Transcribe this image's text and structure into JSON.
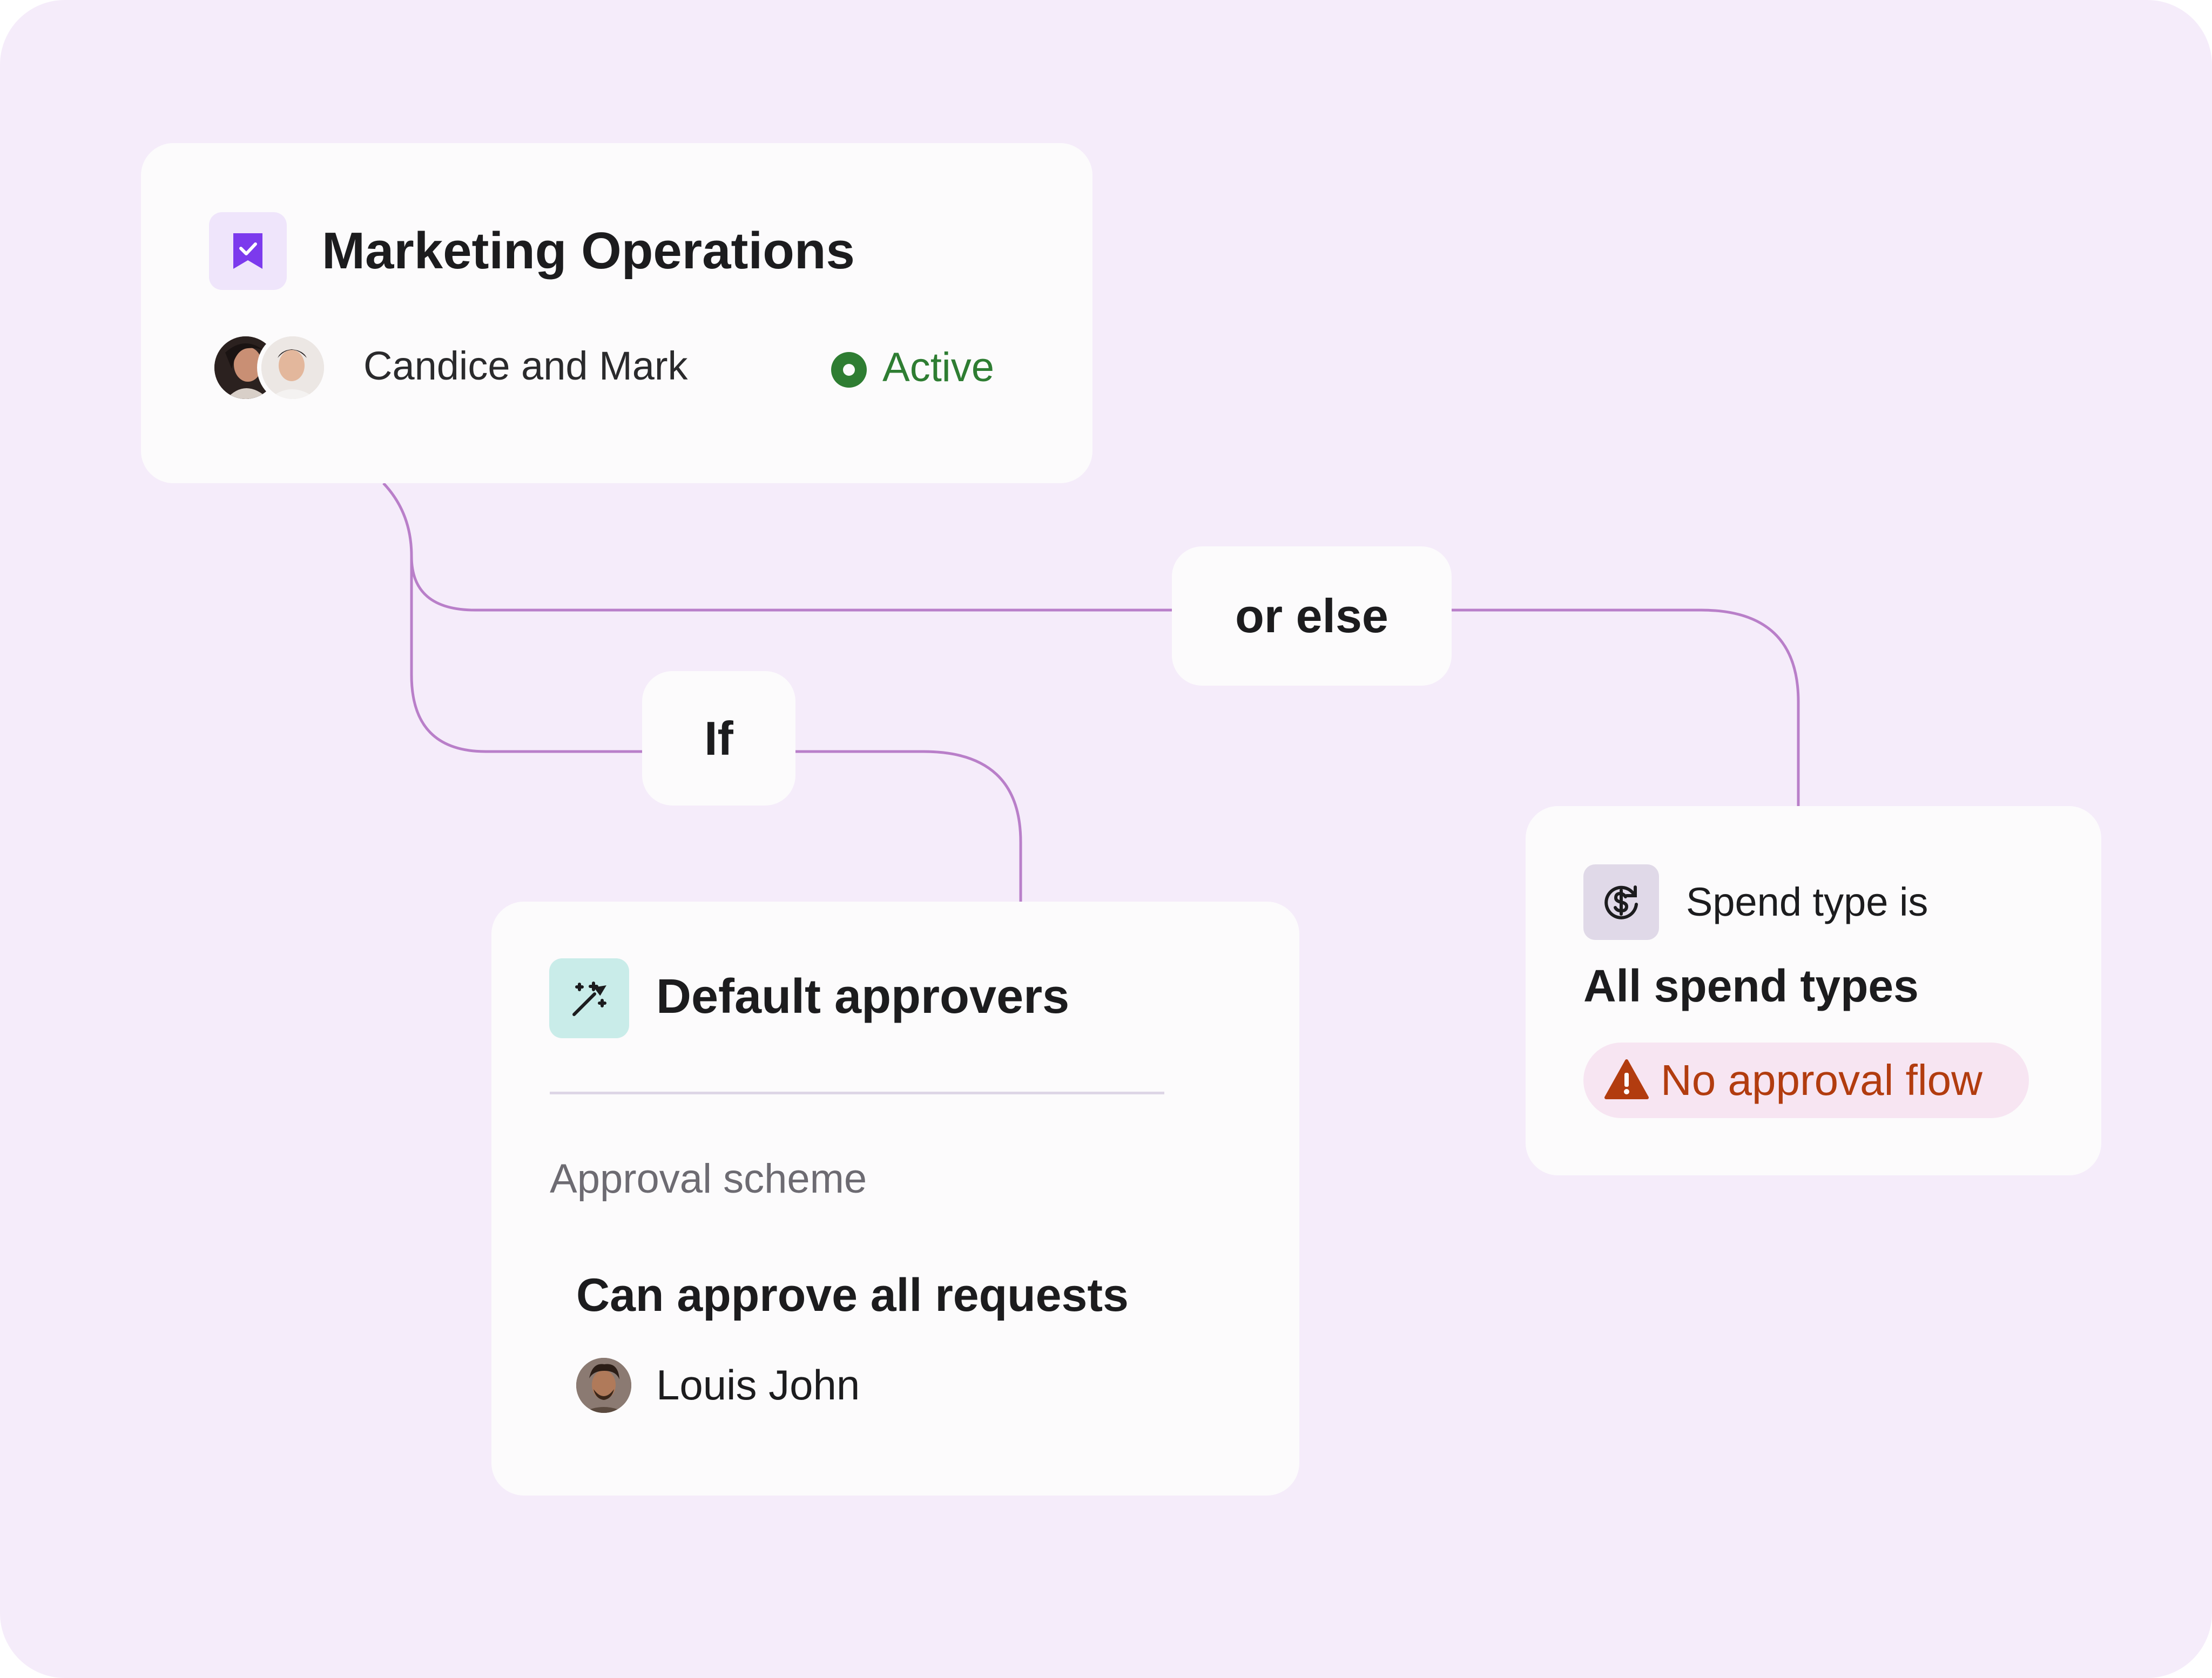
{
  "group_card": {
    "icon": "bookmark-check-icon",
    "title": "Marketing Operations",
    "owners": "Candice and Mark",
    "status": "Active"
  },
  "branches": {
    "if_label": "If",
    "else_label": "or else"
  },
  "default_approvers": {
    "icon": "magic-wand-icon",
    "title": "Default approvers",
    "scheme_label": "Approval scheme",
    "scheme_value": "Can approve all requests",
    "approver": "Louis John"
  },
  "spend_type": {
    "icon": "currency-exchange-icon",
    "label": "Spend type is",
    "value": "All spend types",
    "warning_icon": "warning-icon",
    "warning": "No approval flow"
  },
  "colors": {
    "background": "#f5ecfa",
    "card": "#fcfbfc",
    "connector": "#b97fc9",
    "active": "#2e7d32",
    "warning": "#b23c0f",
    "brand": "#7c3aed"
  }
}
